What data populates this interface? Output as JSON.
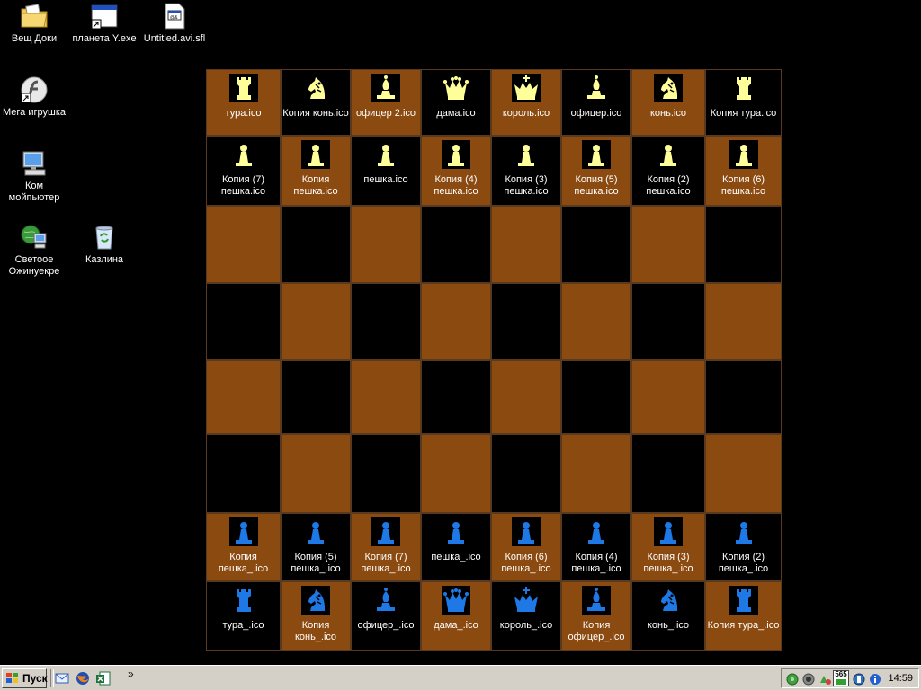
{
  "desktop": {
    "icons": [
      {
        "label": "Вещ Доки",
        "icon": "folder-documents-icon"
      },
      {
        "label": "планета Y.exe",
        "icon": "exe-shortcut-icon"
      },
      {
        "label": "Untitled.avi.sfl",
        "icon": "sfl-file-icon"
      },
      {
        "label": "Мега игрушка",
        "icon": "flash-shortcut-icon"
      },
      {
        "label": "Ком мойпьютер",
        "icon": "computer-icon"
      },
      {
        "label": "Светоое Ожинуекре",
        "icon": "network-globe-icon"
      },
      {
        "label": "Казлина",
        "icon": "recycle-bin-icon"
      }
    ]
  },
  "colors": {
    "board_brown": "#8b4a10",
    "board_black": "#000000",
    "piece_yellow": "#ffff99",
    "piece_blue": "#1e78e6"
  },
  "board": {
    "rows": [
      [
        {
          "label": "тура.ico",
          "piece": "rook",
          "side": "yellow"
        },
        {
          "label": "Копия конь.ico",
          "piece": "knight",
          "side": "yellow"
        },
        {
          "label": "офицер 2.ico",
          "piece": "bishop",
          "side": "yellow"
        },
        {
          "label": "дама.ico",
          "piece": "queen",
          "side": "yellow"
        },
        {
          "label": "король.ico",
          "piece": "king",
          "side": "yellow"
        },
        {
          "label": "офицер.ico",
          "piece": "bishop",
          "side": "yellow"
        },
        {
          "label": "конь.ico",
          "piece": "knight",
          "side": "yellow"
        },
        {
          "label": "Копия тура.ico",
          "piece": "rook",
          "side": "yellow"
        }
      ],
      [
        {
          "label": "Копия (7) пешка.ico",
          "piece": "pawn",
          "side": "yellow"
        },
        {
          "label": "Копия пешка.ico",
          "piece": "pawn",
          "side": "yellow"
        },
        {
          "label": "пешка.ico",
          "piece": "pawn",
          "side": "yellow"
        },
        {
          "label": "Копия (4) пешка.ico",
          "piece": "pawn",
          "side": "yellow"
        },
        {
          "label": "Копия (3) пешка.ico",
          "piece": "pawn",
          "side": "yellow"
        },
        {
          "label": "Копия (5) пешка.ico",
          "piece": "pawn",
          "side": "yellow"
        },
        {
          "label": "Копия (2) пешка.ico",
          "piece": "pawn",
          "side": "yellow"
        },
        {
          "label": "Копия (6) пешка.ico",
          "piece": "pawn",
          "side": "yellow"
        }
      ],
      [
        null,
        null,
        null,
        null,
        null,
        null,
        null,
        null
      ],
      [
        null,
        null,
        null,
        null,
        null,
        null,
        null,
        null
      ],
      [
        null,
        null,
        null,
        null,
        null,
        null,
        null,
        null
      ],
      [
        null,
        null,
        null,
        null,
        null,
        null,
        null,
        null
      ],
      [
        {
          "label": "Копия пешка_.ico",
          "piece": "pawn",
          "side": "blue"
        },
        {
          "label": "Копия (5) пешка_.ico",
          "piece": "pawn",
          "side": "blue"
        },
        {
          "label": "Копия (7) пешка_.ico",
          "piece": "pawn",
          "side": "blue"
        },
        {
          "label": "пешка_.ico",
          "piece": "pawn",
          "side": "blue"
        },
        {
          "label": "Копия (6) пешка_.ico",
          "piece": "pawn",
          "side": "blue"
        },
        {
          "label": "Копия (4) пешка_.ico",
          "piece": "pawn",
          "side": "blue"
        },
        {
          "label": "Копия (3) пешка_.ico",
          "piece": "pawn",
          "side": "blue"
        },
        {
          "label": "Копия (2) пешка_.ico",
          "piece": "pawn",
          "side": "blue"
        }
      ],
      [
        {
          "label": "тура_.ico",
          "piece": "rook",
          "side": "blue"
        },
        {
          "label": "Копия конь_.ico",
          "piece": "knight",
          "side": "blue"
        },
        {
          "label": "офицер_.ico",
          "piece": "bishop",
          "side": "blue"
        },
        {
          "label": "дама_.ico",
          "piece": "queen",
          "side": "blue"
        },
        {
          "label": "король_.ico",
          "piece": "king",
          "side": "blue"
        },
        {
          "label": "Копия офицер_.ico",
          "piece": "bishop",
          "side": "blue"
        },
        {
          "label": "конь_.ico",
          "piece": "knight",
          "side": "blue"
        },
        {
          "label": "Копия тура_.ico",
          "piece": "rook",
          "side": "blue"
        }
      ]
    ]
  },
  "taskbar": {
    "start_label": "Пуск",
    "quick_launch": [
      "outlook-express-icon",
      "firefox-icon",
      "excel-icon"
    ],
    "chevron": "»",
    "tray_icons": [
      "network-icon",
      "speaker-icon",
      "recycle-tray-icon",
      "counter-icon",
      "media-icon",
      "info-icon"
    ],
    "tray_counter": "565",
    "clock": "14:59"
  }
}
